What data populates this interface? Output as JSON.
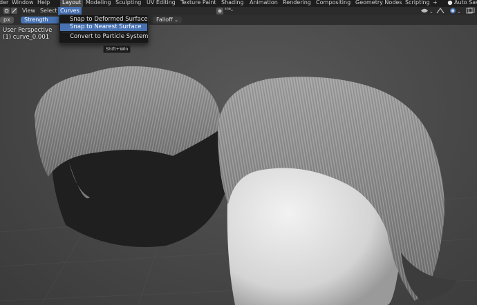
{
  "topbar": {
    "menu_partial": "der",
    "window": "Window",
    "help": "Help",
    "tabs": [
      "Layout",
      "Modeling",
      "Sculpting",
      "UV Editing",
      "Texture Paint",
      "Shading",
      "Animation",
      "Rendering",
      "Compositing",
      "Geometry Nodes",
      "Scripting"
    ],
    "add_tab": "+",
    "autosave": "Auto Sav"
  },
  "header": {
    "view": "View",
    "select": "Select",
    "curves": "Curves",
    "snap_label": "sna"
  },
  "toolbar": {
    "radius_unit": "px",
    "strength": "Strength",
    "falloff": "Falloff"
  },
  "viewport": {
    "perspective": "User Perspective",
    "object_name": "(1) curve_0.001"
  },
  "curves_menu": {
    "items": [
      "Snap to Deformed Surface",
      "Snap to Nearest Surface",
      "Convert to Particle System"
    ],
    "highlighted_index": 1
  },
  "tooltip": "Shift+Win",
  "colors": {
    "accent": "#4772b3",
    "menu_bg": "#181818",
    "topbar_bg": "#1d1d1d"
  }
}
